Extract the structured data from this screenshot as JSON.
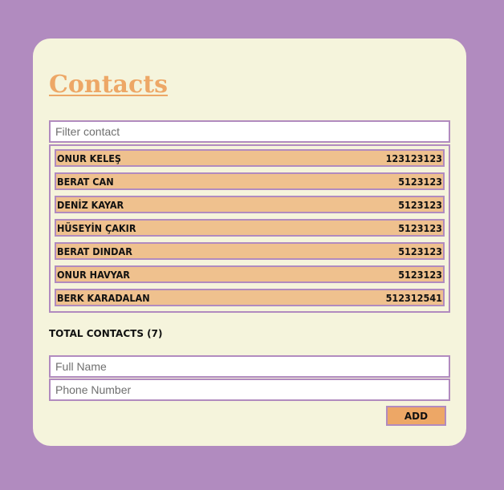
{
  "header": {
    "title": "Contacts"
  },
  "filter": {
    "placeholder": "Filter contact",
    "value": ""
  },
  "contacts": [
    {
      "name": "ONUR KELEŞ",
      "phone": "123123123"
    },
    {
      "name": "BERAT CAN",
      "phone": "5123123"
    },
    {
      "name": "DENİZ KAYAR",
      "phone": "5123123"
    },
    {
      "name": "HÜSEYİN ÇAKIR",
      "phone": "5123123"
    },
    {
      "name": "BERAT DINDAR",
      "phone": "5123123"
    },
    {
      "name": "ONUR HAVYAR",
      "phone": "5123123"
    },
    {
      "name": "BERK KARADALAN",
      "phone": "512312541"
    }
  ],
  "summary": {
    "total_label": "TOTAL CONTACTS (7)"
  },
  "form": {
    "name_placeholder": "Full Name",
    "phone_placeholder": "Phone Number",
    "add_label": "ADD"
  },
  "colors": {
    "background": "#b18bbf",
    "card": "#f5f4dc",
    "accent": "#eda766",
    "row": "#efc18e",
    "border": "#b18bbf"
  }
}
